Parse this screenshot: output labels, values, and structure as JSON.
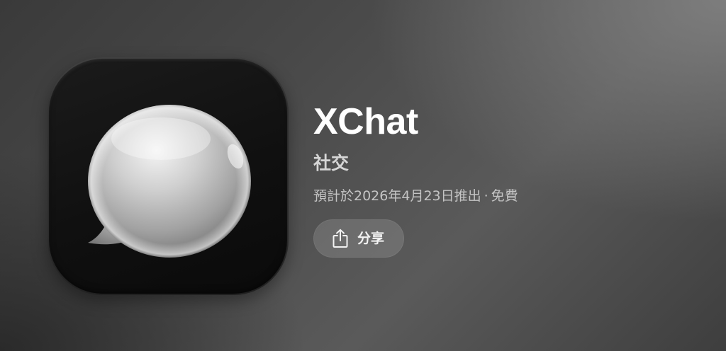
{
  "app": {
    "name": "XChat",
    "category": "社交",
    "release_text": "預計於2026年4月23日推出",
    "separator": "·",
    "price": "免費",
    "icon": "speech-bubble-icon"
  },
  "actions": {
    "share_label": "分享",
    "share_icon": "share-icon"
  }
}
